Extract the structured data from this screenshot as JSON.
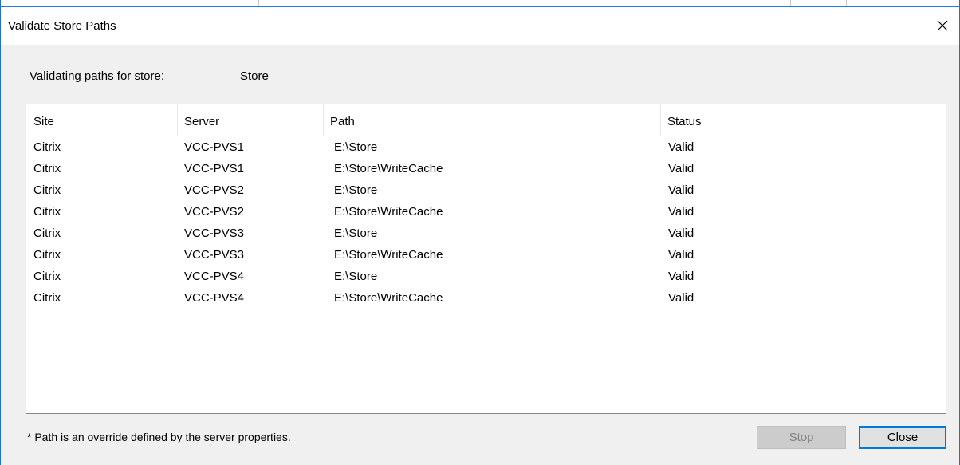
{
  "window": {
    "title": "Validate Store Paths",
    "close_glyph": "×"
  },
  "store": {
    "label": "Validating paths for store:",
    "value": "Store"
  },
  "table": {
    "columns": [
      "Site",
      "Server",
      "Path",
      "Status"
    ],
    "rows": [
      {
        "site": "Citrix",
        "server": "VCC-PVS1",
        "path": "E:\\Store",
        "status": "Valid"
      },
      {
        "site": "Citrix",
        "server": "VCC-PVS1",
        "path": "E:\\Store\\WriteCache",
        "status": "Valid"
      },
      {
        "site": "Citrix",
        "server": "VCC-PVS2",
        "path": "E:\\Store",
        "status": "Valid"
      },
      {
        "site": "Citrix",
        "server": "VCC-PVS2",
        "path": "E:\\Store\\WriteCache",
        "status": "Valid"
      },
      {
        "site": "Citrix",
        "server": "VCC-PVS3",
        "path": "E:\\Store",
        "status": "Valid"
      },
      {
        "site": "Citrix",
        "server": "VCC-PVS3",
        "path": "E:\\Store\\WriteCache",
        "status": "Valid"
      },
      {
        "site": "Citrix",
        "server": "VCC-PVS4",
        "path": "E:\\Store",
        "status": "Valid"
      },
      {
        "site": "Citrix",
        "server": "VCC-PVS4",
        "path": "E:\\Store\\WriteCache",
        "status": "Valid"
      }
    ]
  },
  "footer": {
    "note": "* Path is an override defined by the server properties.",
    "stop_label": "Stop",
    "close_label": "Close"
  },
  "colors": {
    "accent": "#0078d7",
    "window_border": "#1e73c8",
    "disabled_button": "#cccccc"
  },
  "icons": {
    "close": "close-icon"
  }
}
